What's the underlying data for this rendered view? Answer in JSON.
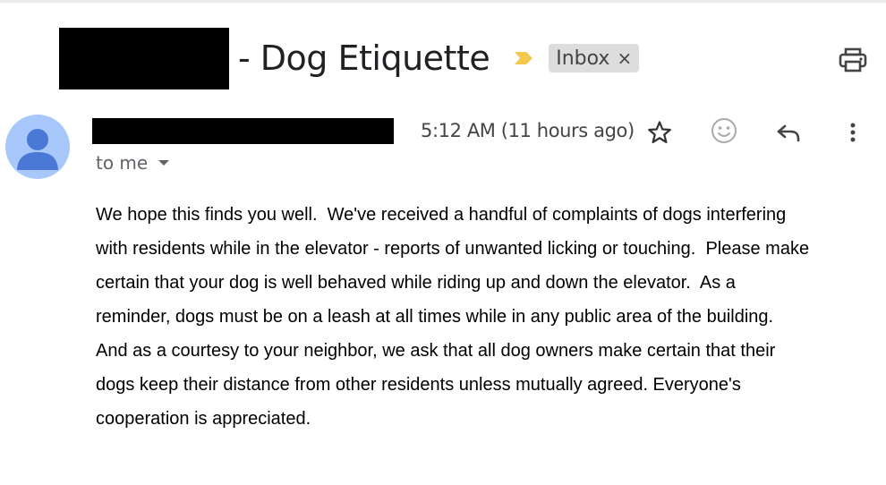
{
  "header": {
    "subject": "- Dog Etiquette",
    "label": "Inbox",
    "label_remove": "×",
    "importance_color": "#f2c94c"
  },
  "message": {
    "timestamp": "5:12 AM (11 hours ago)",
    "recipient": "to me",
    "body_lines": [
      "We hope this finds you well.  We've received a handful of complaints of dogs interfering",
      "with residents while in the elevator - reports of unwanted licking or touching.  Please make",
      "certain that your dog is well behaved while riding up and down the elevator.  As a",
      "reminder, dogs must be on a leash at all times while in any public area of the building.",
      "And as a courtesy to your neighbor, we ask that all dog owners make certain that their",
      "dogs keep their distance from other residents unless mutually agreed. Everyone's",
      "cooperation is appreciated."
    ]
  },
  "icons": {
    "print": "print-icon",
    "star": "star-icon",
    "emoji": "emoji-icon",
    "reply": "reply-icon",
    "more": "more-vert-icon",
    "avatar": "person-icon"
  },
  "colors": {
    "avatar_bg": "#a8c7fa",
    "avatar_fg": "#4a78d6",
    "chip_bg": "#dddddd"
  }
}
